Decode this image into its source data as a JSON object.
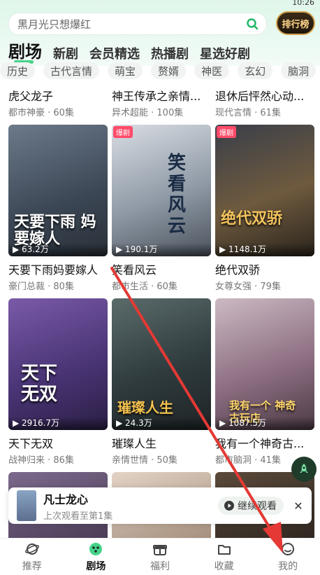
{
  "status": {
    "time": "10:26"
  },
  "search": {
    "placeholder": "黑月光只想爆红"
  },
  "rank_button": {
    "label": "排行榜"
  },
  "tabs": [
    "剧场",
    "新剧",
    "会员精选",
    "热播剧",
    "星选好剧"
  ],
  "chips": [
    "历史",
    "古代言情",
    "萌宝",
    "赘婿",
    "神医",
    "玄幻",
    "脑洞"
  ],
  "row1": [
    {
      "title": "虎父龙子",
      "meta": "都市神豪 · 60集"
    },
    {
      "title": "神王传承之亲情...",
      "meta": "异术超能 · 100集"
    },
    {
      "title": "退休后怦然心动...",
      "meta": "现代言情 · 61集"
    }
  ],
  "row2": [
    {
      "title": "天要下雨妈要嫁人",
      "meta": "豪门总裁 · 80集",
      "plays": "63.2万",
      "badge": "",
      "overlay": "天要下雨 妈要嫁人"
    },
    {
      "title": "笑看风云",
      "meta": "都市生活 · 60集",
      "plays": "190.1万",
      "badge": "爆剧",
      "overlay": "笑看风云"
    },
    {
      "title": "绝代双骄",
      "meta": "女尊女强 · 79集",
      "plays": "1148.1万",
      "badge": "爆剧",
      "overlay": "绝代双骄"
    }
  ],
  "row3": [
    {
      "title": "天下无双",
      "meta": "战神归来 · 86集",
      "plays": "2916.7万",
      "overlay": "天下 无双"
    },
    {
      "title": "璀璨人生",
      "meta": "亲情世情 · 50集",
      "plays": "24.3万",
      "overlay": "璀璨人生"
    },
    {
      "title": "我有一个神奇古...",
      "meta": "都市脑洞 · 41集",
      "plays": "1087.5万",
      "overlay": "我有一个 神奇古玩店"
    }
  ],
  "continue_watch": {
    "title": "凡士龙心",
    "subtitle": "上次观看至第1集",
    "button": "继续观看"
  },
  "bottom_nav": [
    "推荐",
    "剧场",
    "福利",
    "收藏",
    "我的"
  ],
  "colors": {
    "accent": "#46d38a",
    "arrow": "#e53935"
  }
}
